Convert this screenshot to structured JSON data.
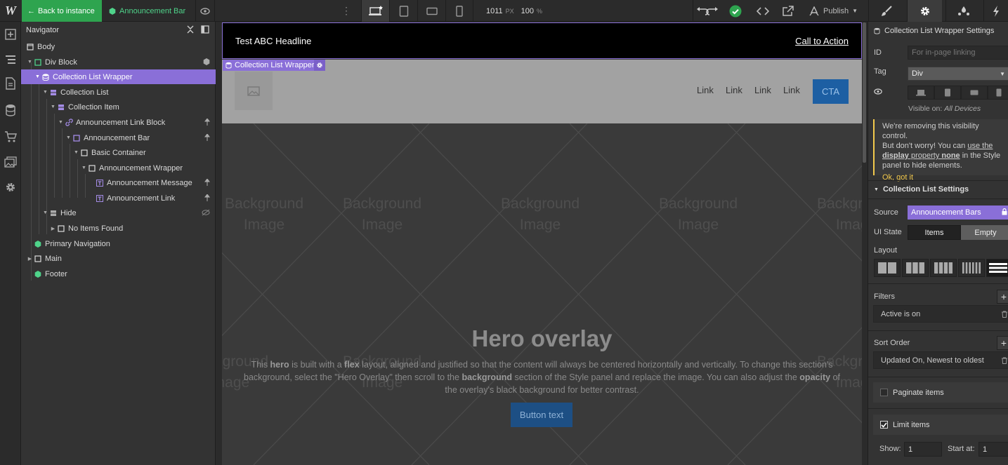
{
  "topbar": {
    "back_label": "Back to instance",
    "component_tab": "Announcement Bar",
    "width_value": "1011",
    "width_unit": "PX",
    "zoom_value": "100",
    "zoom_unit": "%",
    "publish_label": "Publish"
  },
  "navigator": {
    "title": "Navigator",
    "items": [
      {
        "label": "Body"
      },
      {
        "label": "Div Block"
      },
      {
        "label": "Collection List Wrapper"
      },
      {
        "label": "Collection List"
      },
      {
        "label": "Collection Item"
      },
      {
        "label": "Announcement Link Block"
      },
      {
        "label": "Announcement Bar"
      },
      {
        "label": "Basic Container"
      },
      {
        "label": "Announcement Wrapper"
      },
      {
        "label": "Announcement Message"
      },
      {
        "label": "Announcement Link"
      },
      {
        "label": "Hide"
      },
      {
        "label": "No Items Found"
      },
      {
        "label": "Primary Navigation"
      },
      {
        "label": "Main"
      },
      {
        "label": "Footer"
      }
    ]
  },
  "canvas": {
    "announcement_headline": "Test ABC Headline",
    "announcement_cta": "Call to Action",
    "selection_label": "Collection List Wrapper",
    "nav_links": [
      "Link",
      "Link",
      "Link",
      "Link"
    ],
    "nav_cta": "CTA",
    "bg_label_line1": "Background",
    "bg_label_line2": "Image",
    "hero_title": "Hero overlay",
    "hero_p1": "This ",
    "hero_b1": "hero",
    "hero_p2": " is built with a ",
    "hero_b2": "flex",
    "hero_p3": " layout, aligned and justified so that the content will always be centered horizontally and vertically. To change this section's background, select the \"Hero Overlay\" then scroll to the ",
    "hero_b3": "background",
    "hero_p4": " section of the Style panel and replace the image. You can also adjust the ",
    "hero_b4": "opacity",
    "hero_p5": " of the overlay's black background for better contrast.",
    "hero_button": "Button text"
  },
  "settings": {
    "header": "Collection List Wrapper Settings",
    "id_label": "ID",
    "id_placeholder": "For in-page linking",
    "tag_label": "Tag",
    "tag_value": "Div",
    "visible_on_prefix": "Visible on:",
    "visible_on_value": "All Devices",
    "notice_l1": "We're removing this visibility control.",
    "notice_l2a": "But don't worry! You can ",
    "notice_l2b": "use the",
    "notice_l3a": "display",
    "notice_l3b": " property ",
    "notice_l3c": "none",
    "notice_l3d": " in the Style",
    "notice_l4": "panel to hide elements.",
    "notice_ok": "Ok, got it",
    "cls_header": "Collection List Settings",
    "source_label": "Source",
    "source_value": "Announcement Bars",
    "ui_state_label": "UI State",
    "ui_state_items": "Items",
    "ui_state_empty": "Empty",
    "layout_label": "Layout",
    "filters_label": "Filters",
    "filter_value": "Active is on",
    "sort_label": "Sort Order",
    "sort_value": "Updated On, Newest to oldest",
    "paginate_label": "Paginate items",
    "limit_label": "Limit items",
    "show_label": "Show:",
    "show_value": "1",
    "start_label": "Start at:",
    "start_value": "1"
  },
  "colors": {
    "accent": "#8a6fd8",
    "green": "#2ea44f",
    "component": "#4fd38a",
    "notice": "#f2c94c"
  }
}
